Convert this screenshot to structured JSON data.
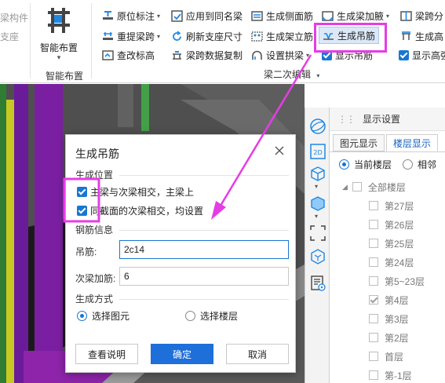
{
  "left_stub": {
    "line1": "梁构件",
    "line2": "支座"
  },
  "smart_layout": {
    "button_label": "智能布置",
    "caret": "▾",
    "group_label": "智能布置"
  },
  "ribbon": {
    "col1": [
      {
        "label": "原位标注",
        "caret": "▾"
      },
      {
        "label": "重提梁跨",
        "caret": "▾"
      },
      {
        "label": "查改标高",
        "caret": ""
      }
    ],
    "col2": [
      {
        "label": "应用到同名梁"
      },
      {
        "label": "刷新支座尺寸"
      },
      {
        "label": "梁跨数据复制"
      }
    ],
    "col3": [
      {
        "label": "生成侧面筋"
      },
      {
        "label": "生成架立筋"
      },
      {
        "label": "设置拱梁",
        "caret": "▾"
      }
    ],
    "col4": {
      "haunch": "生成梁加腋",
      "haunch_caret": "▾",
      "hanger": "生成吊筋",
      "show_hanger": "显示吊筋"
    },
    "col5": {
      "span": "梁跨分",
      "gen_height": "生成高",
      "show_height": "显示高强"
    },
    "group_label": "梁二次编辑",
    "group_caret": "▾"
  },
  "toolbar_icons": [
    "rotate-icon",
    "2d-view-icon",
    "3d-box-icon",
    "solid-box-icon",
    "select-frame-icon",
    "layer-cube-icon",
    "display-list-icon"
  ],
  "right_panel": {
    "title": "显示设置",
    "tabs": [
      "图元显示",
      "楼层显示"
    ],
    "active_tab": 1,
    "radio_current": "当前楼层",
    "radio_related": "相邻",
    "all_floors": "全部楼层",
    "floors": [
      {
        "label": "第27层",
        "checked": false
      },
      {
        "label": "第26层",
        "checked": false
      },
      {
        "label": "第25层",
        "checked": false
      },
      {
        "label": "第24层",
        "checked": false
      },
      {
        "label": "第5~23层",
        "checked": false
      },
      {
        "label": "第4层",
        "checked": true
      },
      {
        "label": "第3层",
        "checked": false
      },
      {
        "label": "第2层",
        "checked": false
      },
      {
        "label": "首层",
        "checked": false
      },
      {
        "label": "第-1层",
        "checked": false
      }
    ]
  },
  "dialog": {
    "title": "生成吊筋",
    "section_position": "生成位置",
    "opt1": "主梁与次梁相交，主梁上",
    "opt2": "同截面的次梁相交，均设置",
    "section_rebar": "钢筋信息",
    "hanger_label": "吊筋:",
    "hanger_value": "2c14",
    "extra_label": "次梁加筋:",
    "extra_value": "6",
    "section_mode": "生成方式",
    "mode_select": "选择图元",
    "mode_floor": "选择楼层",
    "btn_help": "查看说明",
    "btn_ok": "确定",
    "btn_cancel": "取消"
  },
  "colors": {
    "accent": "#1e6fd9",
    "annotation": "#e63ce6",
    "canvas": "#4a4a4a"
  }
}
